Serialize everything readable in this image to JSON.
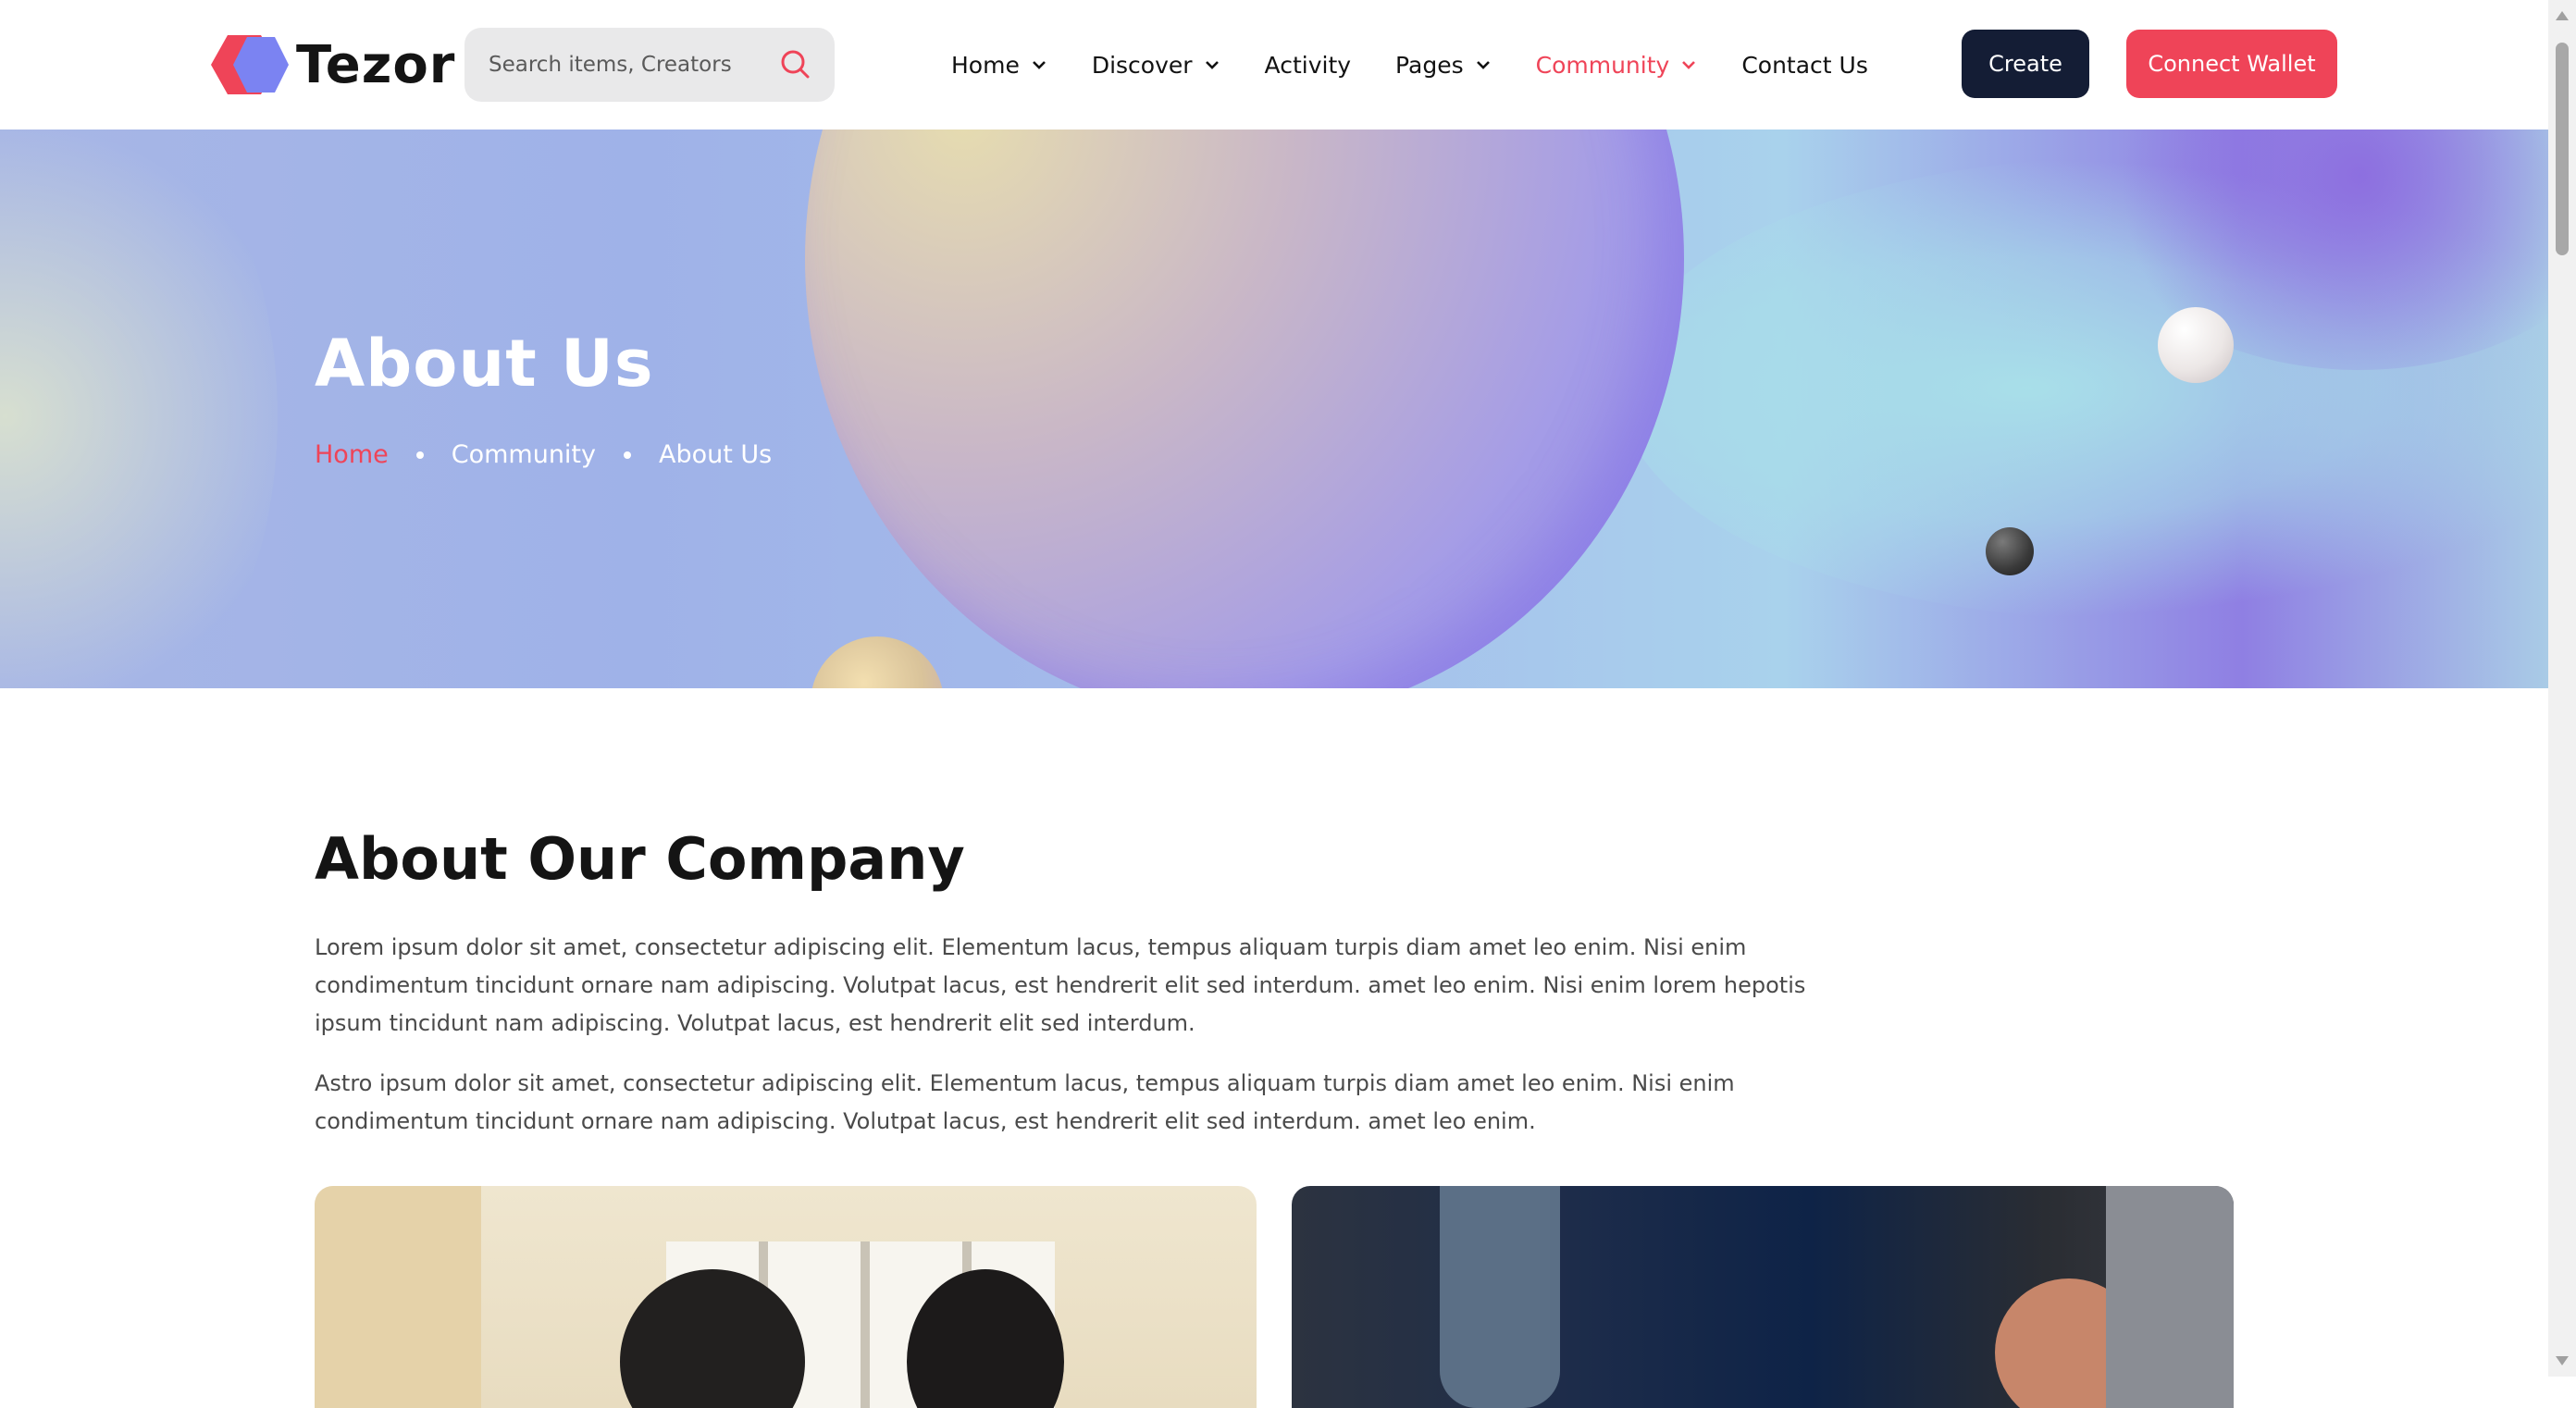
{
  "header": {
    "logo_text": "Tezor",
    "search": {
      "placeholder": "Search items, Creators",
      "icon": "search-icon"
    },
    "nav": [
      {
        "label": "Home",
        "has_dropdown": true,
        "active": false
      },
      {
        "label": "Discover",
        "has_dropdown": true,
        "active": false
      },
      {
        "label": "Activity",
        "has_dropdown": false,
        "active": false
      },
      {
        "label": "Pages",
        "has_dropdown": true,
        "active": false
      },
      {
        "label": "Community",
        "has_dropdown": true,
        "active": true
      },
      {
        "label": "Contact Us",
        "has_dropdown": false,
        "active": false
      }
    ],
    "create_label": "Create",
    "wallet_label": "Connect Wallet"
  },
  "hero": {
    "title": "About Us",
    "breadcrumb": [
      "Home",
      "Community",
      "About Us"
    ]
  },
  "about": {
    "title": "About Our Company",
    "paragraphs": [
      "Lorem ipsum dolor sit amet, consectetur adipiscing elit. Elementum lacus, tempus aliquam turpis diam amet leo enim. Nisi enim condimentum tincidunt ornare nam adipiscing. Volutpat lacus, est hendrerit elit sed interdum. amet leo enim. Nisi enim lorem hepotis ipsum tincidunt nam adipiscing. Volutpat lacus, est hendrerit elit sed interdum.",
      "Astro ipsum dolor sit amet, consectetur adipiscing elit. Elementum lacus, tempus aliquam turpis diam amet leo enim. Nisi enim condimentum tincidunt ornare nam adipiscing. Volutpat lacus, est hendrerit elit sed interdum. amet leo enim."
    ]
  },
  "colors": {
    "accent": "#ef4458",
    "dark_button": "#141d35",
    "text": "#121212"
  }
}
